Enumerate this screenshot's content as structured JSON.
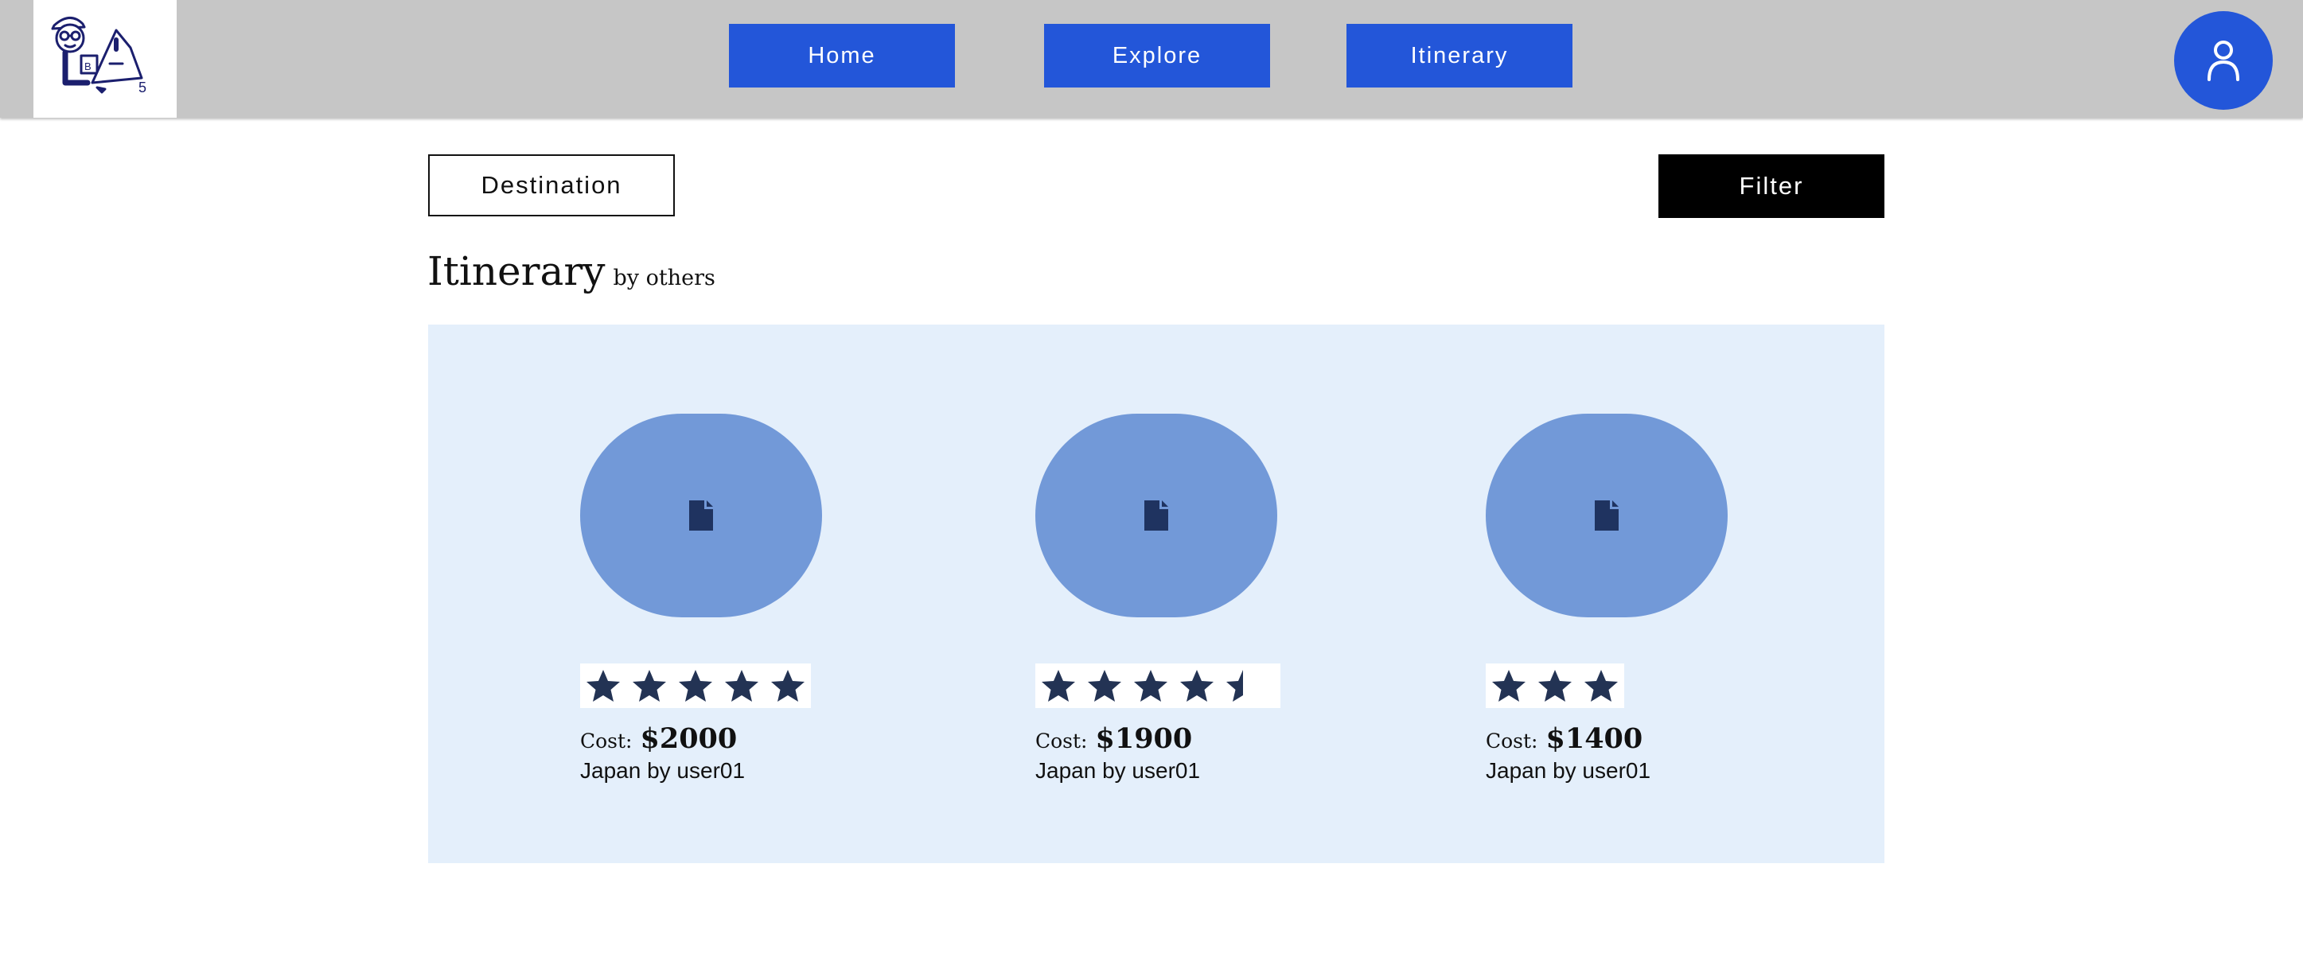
{
  "header": {
    "logo_icon": "cartoon-traveler-logo",
    "logo_mark": "5",
    "nav": [
      {
        "label": "Home"
      },
      {
        "label": "Explore"
      },
      {
        "label": "Itinerary"
      }
    ],
    "profile_icon": "user-icon",
    "accent_color": "#2356d9"
  },
  "toolbar": {
    "destination_label": "Destination",
    "filter_label": "Filter"
  },
  "section": {
    "title": "Itinerary",
    "subtitle": "by others"
  },
  "cards": [
    {
      "image_icon": "file-icon",
      "rating": 5,
      "cost_label": "Cost:",
      "cost": "$2000",
      "byline": "Japan by user01"
    },
    {
      "image_icon": "file-icon",
      "rating": 4.5,
      "cost_label": "Cost:",
      "cost": "$1900",
      "byline": "Japan by user01"
    },
    {
      "image_icon": "file-icon",
      "rating": 3,
      "cost_label": "Cost:",
      "cost": "$1400",
      "byline": "Japan by user01"
    }
  ]
}
